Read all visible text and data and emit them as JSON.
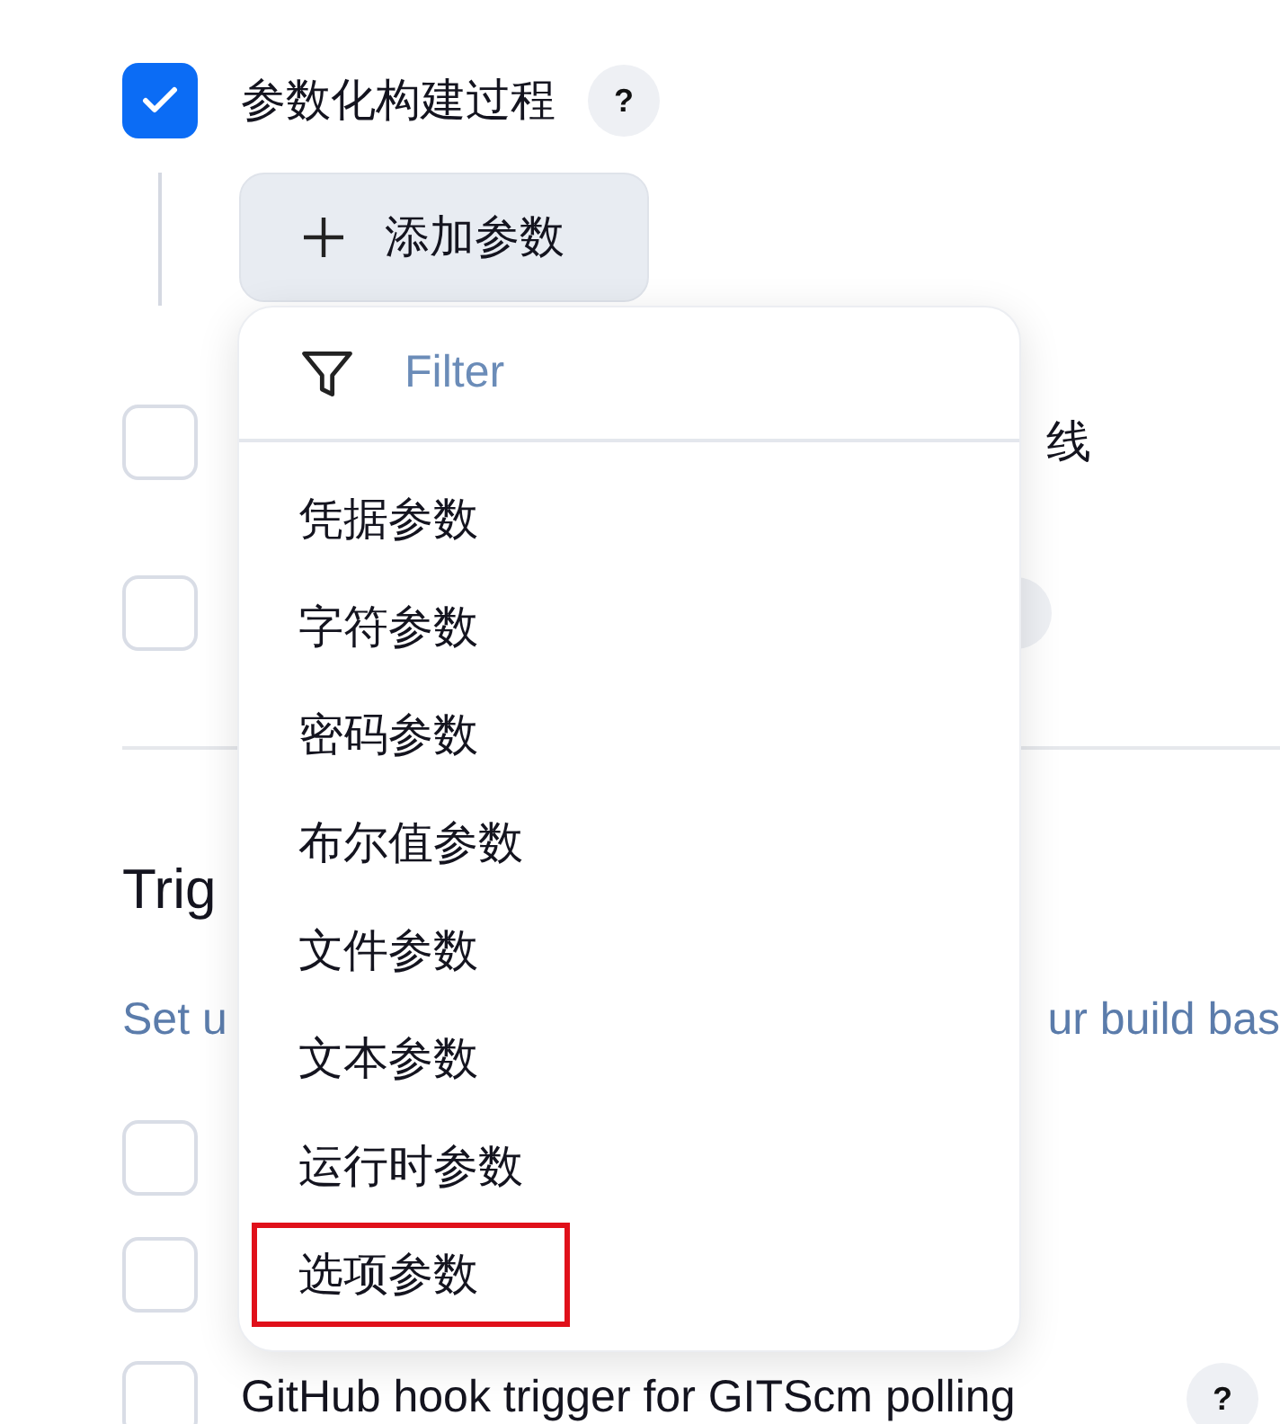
{
  "parameterized": {
    "label": "参数化构建过程",
    "checked": true,
    "help": "?",
    "add_button": "添加参数"
  },
  "hidden_rows": [
    {
      "checked": false,
      "label_tail": "线"
    },
    {
      "checked": false,
      "help_partial": true
    }
  ],
  "triggers": {
    "heading": "Trig",
    "description_start": "Set u",
    "description_end": "ur build bas",
    "rows": [
      {
        "checked": false
      },
      {
        "checked": false
      },
      {
        "checked": false,
        "label": "GitHub hook trigger for GITScm polling",
        "help": "?"
      }
    ]
  },
  "dropdown": {
    "filter": {
      "placeholder": "Filter"
    },
    "items": [
      {
        "label": "凭据参数",
        "highlighted": false
      },
      {
        "label": "字符参数",
        "highlighted": false
      },
      {
        "label": "密码参数",
        "highlighted": false
      },
      {
        "label": "布尔值参数",
        "highlighted": false
      },
      {
        "label": "文件参数",
        "highlighted": false
      },
      {
        "label": "文本参数",
        "highlighted": false
      },
      {
        "label": "运行时参数",
        "highlighted": false
      },
      {
        "label": "选项参数",
        "highlighted": true
      }
    ]
  }
}
